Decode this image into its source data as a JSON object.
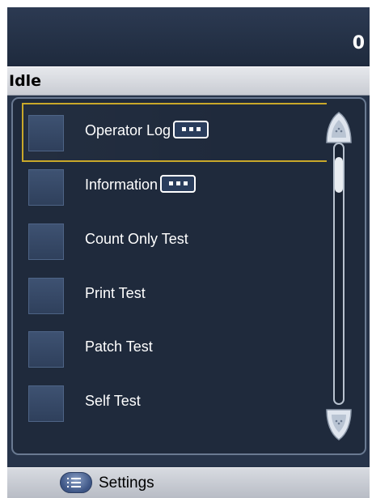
{
  "header": {
    "count": "0"
  },
  "status": {
    "text": "Idle"
  },
  "menu": {
    "items": [
      {
        "label": "Operator Log",
        "has_more": true,
        "selected": true
      },
      {
        "label": "Information",
        "has_more": true,
        "selected": false
      },
      {
        "label": "Count Only Test",
        "has_more": false,
        "selected": false
      },
      {
        "label": "Print Test",
        "has_more": false,
        "selected": false
      },
      {
        "label": "Patch Test",
        "has_more": false,
        "selected": false
      },
      {
        "label": "Self Test",
        "has_more": false,
        "selected": false
      }
    ]
  },
  "scrollbar": {
    "up_icon": "scroll-up-arrow",
    "down_icon": "scroll-down-arrow"
  },
  "footer": {
    "settings_label": "Settings",
    "settings_icon": "list-icon"
  },
  "colors": {
    "background": "#27344a",
    "selection": "#c9a82a",
    "footer": "#c9ccd3"
  }
}
